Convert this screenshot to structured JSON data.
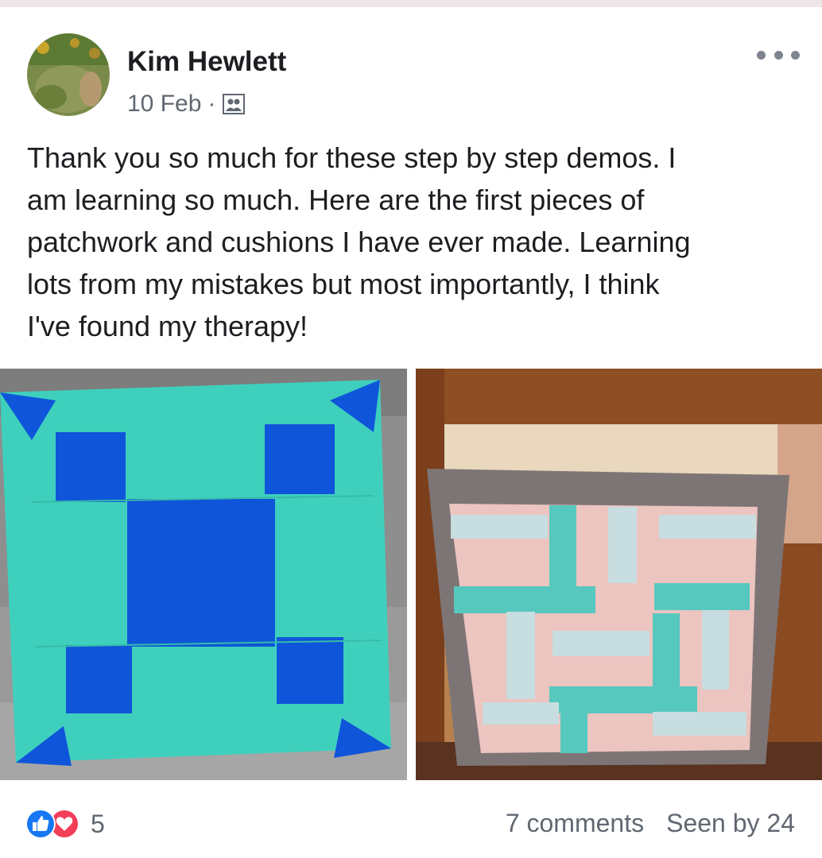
{
  "post": {
    "author": "Kim Hewlett",
    "date": "10 Feb",
    "separator": "·",
    "audience_icon": "group-icon",
    "more_icon": "more-horizontal-icon",
    "text_lines": [
      "Thank you so much for these step by step demos.  I",
      "am learning so much.  Here are the first pieces of",
      "patchwork and cushions I have ever made.  Learning",
      "lots from my mistakes but most importantly, I think",
      "I've found my therapy!"
    ]
  },
  "photos": [
    {
      "name": "nine-patch-cushion-photo",
      "colors": {
        "aqua": "#3fd0bd",
        "blue": "#0f55da",
        "chair": "#8f8f8f"
      }
    },
    {
      "name": "rail-fence-cushion-photo",
      "colors": {
        "pink": "#ecc4c0",
        "teal": "#57c8be",
        "grey_border": "#7d7575",
        "wood": "#9a5a2c"
      }
    }
  ],
  "footer": {
    "reaction_icons": [
      "like-icon",
      "love-icon"
    ],
    "reaction_count": "5",
    "comments": "7 comments",
    "seen_by": "Seen by 24"
  },
  "colors": {
    "text": "#1c1e21",
    "secondary_text": "#606770",
    "like_blue": "#1877f2",
    "love_red": "#f33e58"
  }
}
